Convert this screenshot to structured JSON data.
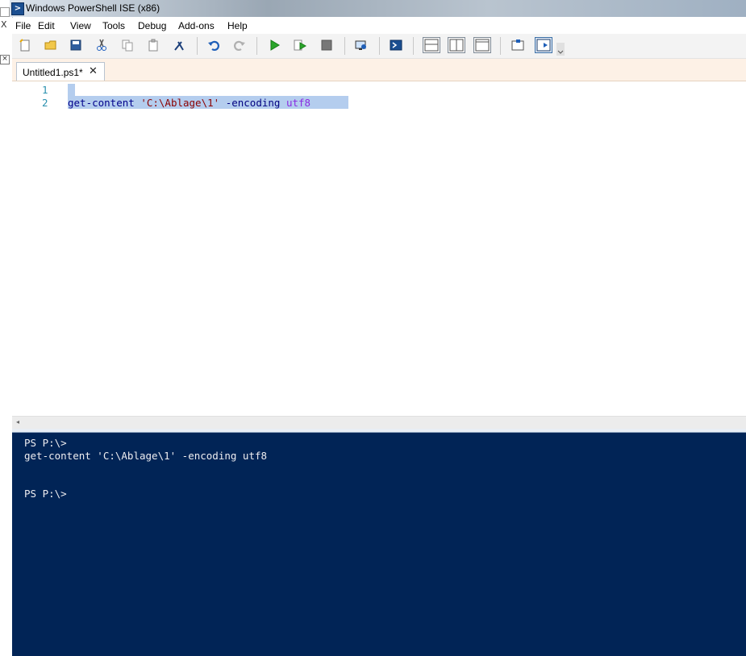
{
  "window": {
    "title": "Windows PowerShell ISE (x86)"
  },
  "menu": [
    "File",
    "Edit",
    "View",
    "Tools",
    "Debug",
    "Add-ons",
    "Help"
  ],
  "toolbar": {
    "buttons": [
      "new-file",
      "open-file",
      "save",
      "cut",
      "copy",
      "paste",
      "clear-console",
      "undo",
      "redo",
      "run-script",
      "run-selection",
      "stop",
      "new-remote-tab",
      "start-powershell",
      "show-script-pane-top",
      "show-script-pane-right",
      "show-script-pane-maximized",
      "show-command-window",
      "show-command-addon"
    ]
  },
  "tab": {
    "label": "Untitled1.ps1*",
    "close": "✕"
  },
  "editor": {
    "line_numbers": [
      "1",
      "2"
    ],
    "line2": {
      "cmd": "get-content",
      "str": "'C:\\Ablage\\1'",
      "param": "-encoding",
      "arg": "utf8"
    }
  },
  "console": {
    "lines": [
      "PS P:\\>",
      "get-content 'C:\\Ablage\\1' -encoding utf8",
      "PS P:\\>"
    ],
    "background": "#012456"
  },
  "colors": {
    "selection": "#b4cdee",
    "line_number": "#2b91af",
    "cmdlet": "#00008b",
    "string": "#8b0000",
    "parameter": "#000080",
    "argument": "#8a2be2"
  }
}
